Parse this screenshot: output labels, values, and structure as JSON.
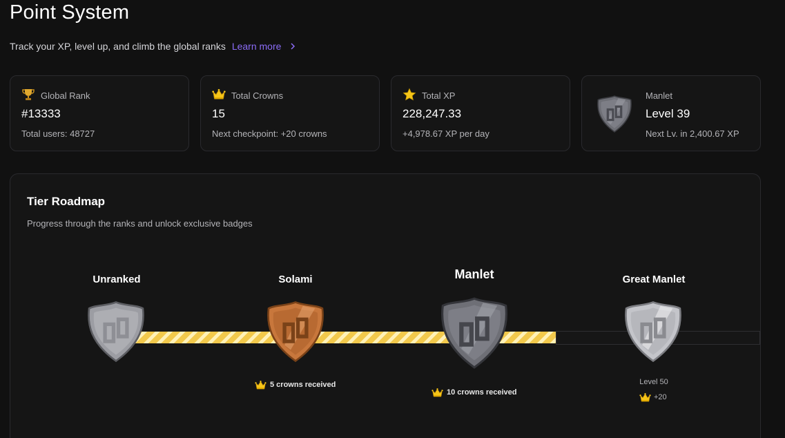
{
  "header": {
    "title": "Point System",
    "subtitle": "Track your XP, level up, and climb the global ranks",
    "learn_more": "Learn more"
  },
  "stats": [
    {
      "icon": "trophy-icon",
      "label": "Global Rank",
      "value": "#13333",
      "sub": "Total users: 48727"
    },
    {
      "icon": "crown-icon",
      "label": "Total Crowns",
      "value": "15",
      "sub": "Next checkpoint: +20 crowns"
    },
    {
      "icon": "star-icon",
      "label": "Total XP",
      "value": "228,247.33",
      "sub": "+4,978.67 XP per day"
    },
    {
      "icon": "manlet-badge-icon",
      "label": "Manlet",
      "value": "Level 39",
      "sub": "Next Lv. in 2,400.67 XP"
    }
  ],
  "roadmap": {
    "title": "Tier Roadmap",
    "subtitle": "Progress through the ranks and unlock exclusive badges",
    "tiers": [
      {
        "name": "Unranked",
        "badge": "unranked-badge-icon"
      },
      {
        "name": "Solami",
        "badge": "solami-badge-icon",
        "note": "5 crowns received"
      },
      {
        "name": "Manlet",
        "badge": "manlet-badge-icon",
        "note": "10 crowns received",
        "current": true
      },
      {
        "name": "Great Manlet",
        "badge": "great-manlet-badge-icon",
        "level": "Level 50",
        "bonus": "+20"
      }
    ],
    "progress_fraction": 0.67
  },
  "colors": {
    "accent": "#8b6cf6",
    "progress": "#f2c94c",
    "crown": "#f5c518",
    "background": "#111111",
    "card": "#151515"
  }
}
